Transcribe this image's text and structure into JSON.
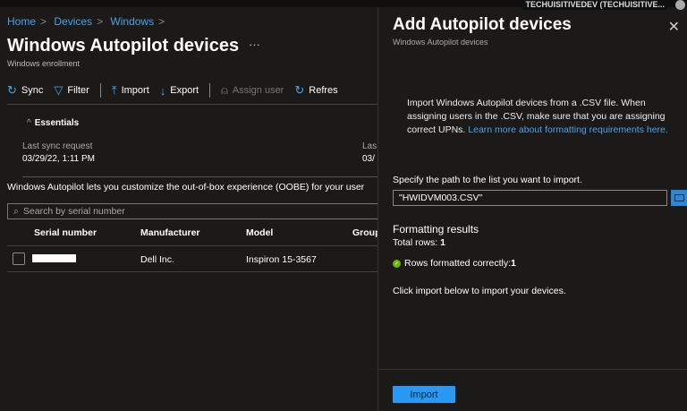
{
  "topbar": {
    "tenant": "TECHUISITIVEDEV (TECHUISITIVE..."
  },
  "breadcrumb": [
    "Home",
    "Devices",
    "Windows"
  ],
  "page": {
    "title": "Windows Autopilot devices",
    "more": "···",
    "subtitle": "Windows enrollment"
  },
  "toolbar": {
    "sync": "Sync",
    "filter": "Filter",
    "import": "Import",
    "export": "Export",
    "assign_user": "Assign user",
    "refresh": "Refres"
  },
  "essentials": {
    "label": "Essentials",
    "last_sync_label": "Last sync request",
    "last_sync_value": "03/29/22, 1:11 PM",
    "col2_label": "Las",
    "col2_value": "03/"
  },
  "description": "Windows Autopilot lets you customize the out-of-box experience (OOBE) for your user",
  "search": {
    "placeholder": "Search by serial number"
  },
  "table": {
    "headers": [
      "Serial number",
      "Manufacturer",
      "Model",
      "Group"
    ],
    "rows": [
      {
        "manufacturer": "Dell Inc.",
        "model": "Inspiron 15-3567"
      }
    ]
  },
  "panel": {
    "title": "Add Autopilot devices",
    "subtitle": "Windows Autopilot devices",
    "close": "✕",
    "intro": "Import Windows Autopilot devices from a .CSV file. When assigning users in the .CSV, make sure that you are assigning correct UPNs. ",
    "intro_link": "Learn more about formatting requirements here.",
    "specify": "Specify the path to the list you want to import.",
    "file_value": "\"HWIDVM003.CSV\"",
    "formatting_results": "Formatting results",
    "total_rows_label": "Total rows: ",
    "total_rows": "1",
    "ok_label": "Rows formatted correctly: ",
    "ok_count": "1",
    "click_import": "Click import below to import your devices.",
    "import_button": "Import"
  }
}
